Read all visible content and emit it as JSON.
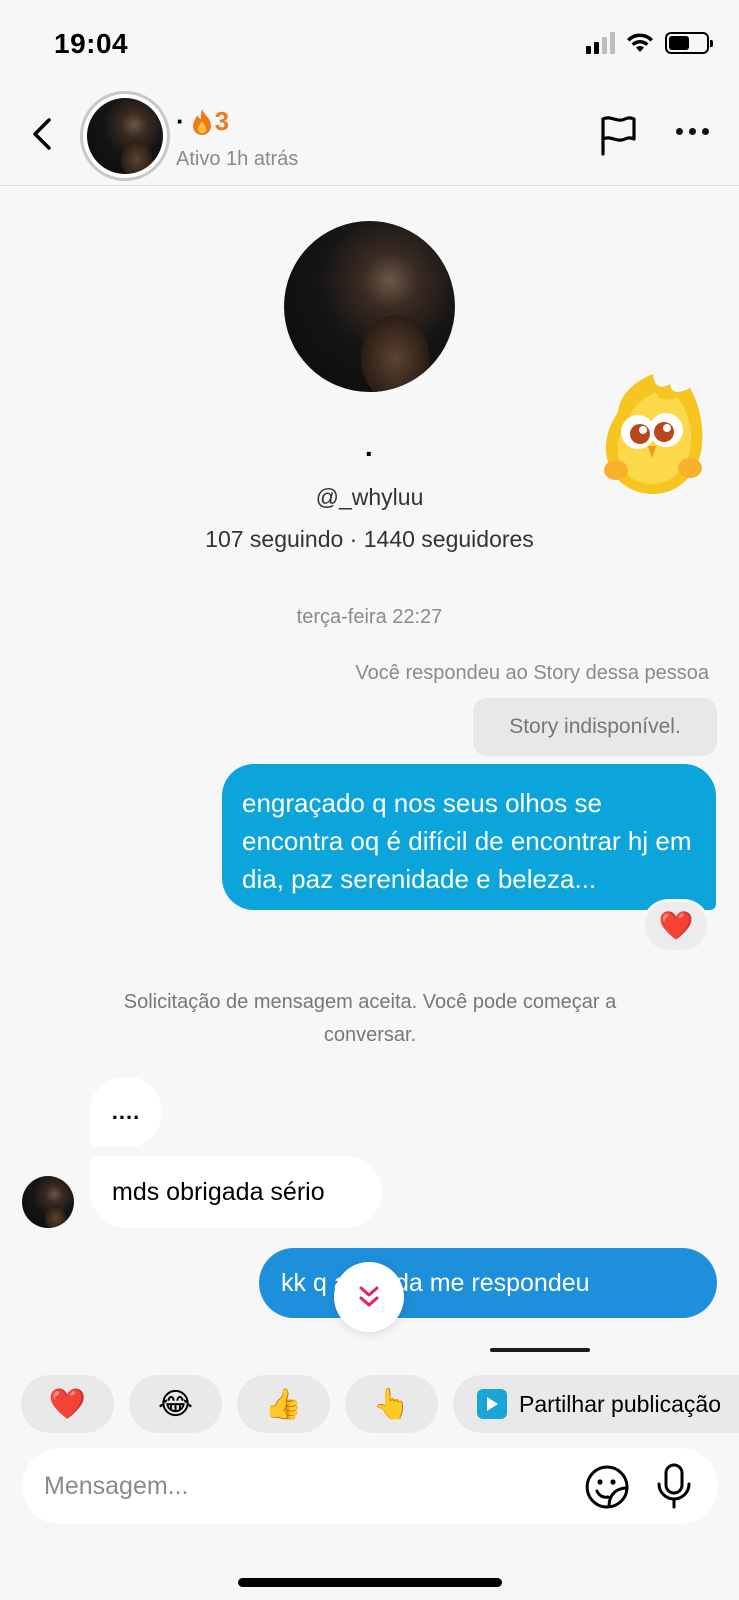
{
  "status_bar": {
    "time": "19:04",
    "icons": [
      "signal-icon",
      "wifi-icon",
      "battery-icon"
    ]
  },
  "header": {
    "name": "·",
    "streak_count": "3",
    "status": "Ativo 1h atrás",
    "icons": [
      "back-arrow-icon",
      "flag-icon",
      "more-dots-icon",
      "fire-icon"
    ]
  },
  "profile": {
    "name": "·",
    "handle": "@_whyluu",
    "stats": "107 seguindo · 1440 seguidores"
  },
  "chat": {
    "date_separator": "terça-feira 22:27",
    "story_reply_note": "Você respondeu ao Story dessa pessoa",
    "story_unavailable": "Story indisponível.",
    "outgoing_1": "engraçado q nos seus olhos se encontra oq é difícil de encontrar hj em dia, paz serenidade e beleza...",
    "outgoing_1_reaction": "❤️",
    "request_accepted_note": "Solicitação de mensagem aceita. Você pode começar a conversar.",
    "incoming_1": "....",
    "incoming_2": "mds obrigada sério",
    "outgoing_2": "kk q        a, ainda me respondeu"
  },
  "quick_reactions": {
    "heart": "❤️",
    "laugh": "😂",
    "thumbs_up": "👍",
    "point_up": "👆",
    "share_label": "Partilhar publicação"
  },
  "composer": {
    "placeholder": "Mensagem..."
  },
  "colors": {
    "outgoing_bubble": "#0ba5db",
    "outgoing_bubble_2": "#1e8fdb",
    "streak": "#f07a1a",
    "scroll_chevron": "#e0245e"
  }
}
